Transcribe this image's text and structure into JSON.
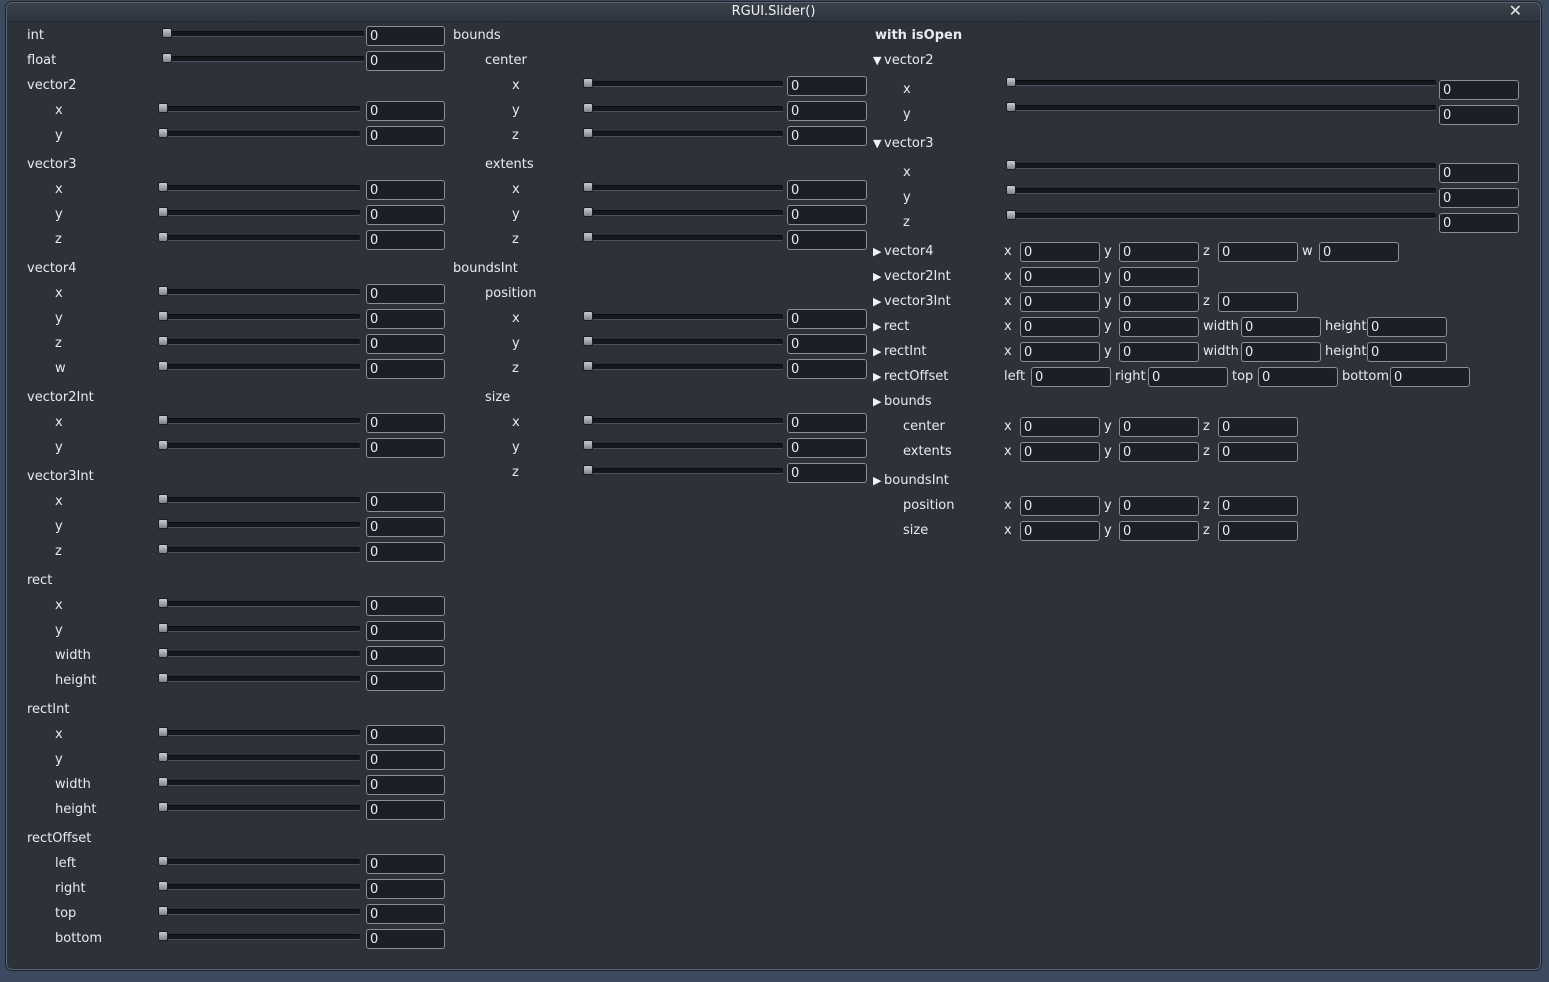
{
  "window": {
    "title": "RGUI.Slider()",
    "close_glyph": "✕"
  },
  "value": "0",
  "col1": {
    "int": "int",
    "float": "float",
    "vector2": "vector2",
    "vector3": "vector3",
    "vector4": "vector4",
    "vector2Int": "vector2Int",
    "vector3Int": "vector3Int",
    "rect": "rect",
    "rectInt": "rectInt",
    "rectOffset": "rectOffset",
    "x": "x",
    "y": "y",
    "z": "z",
    "w": "w",
    "width": "width",
    "height": "height",
    "left": "left",
    "right": "right",
    "top": "top",
    "bottom": "bottom"
  },
  "col2": {
    "bounds": "bounds",
    "center": "center",
    "extents": "extents",
    "boundsInt": "boundsInt",
    "position": "position",
    "size": "size",
    "x": "x",
    "y": "y",
    "z": "z"
  },
  "col3": {
    "header": "with isOpen",
    "open_glyph": "▼",
    "closed_glyph": "▶",
    "vector2": "vector2",
    "vector3": "vector3",
    "vector4": "vector4",
    "vector2Int": "vector2Int",
    "vector3Int": "vector3Int",
    "rect": "rect",
    "rectInt": "rectInt",
    "rectOffset": "rectOffset",
    "bounds": "bounds",
    "boundsInt": "boundsInt",
    "center": "center",
    "extents": "extents",
    "position": "position",
    "size": "size",
    "x": "x",
    "y": "y",
    "z": "z",
    "w": "w",
    "width": "width",
    "height": "height",
    "left": "left",
    "right": "right",
    "top": "top",
    "bottom": "bottom"
  }
}
